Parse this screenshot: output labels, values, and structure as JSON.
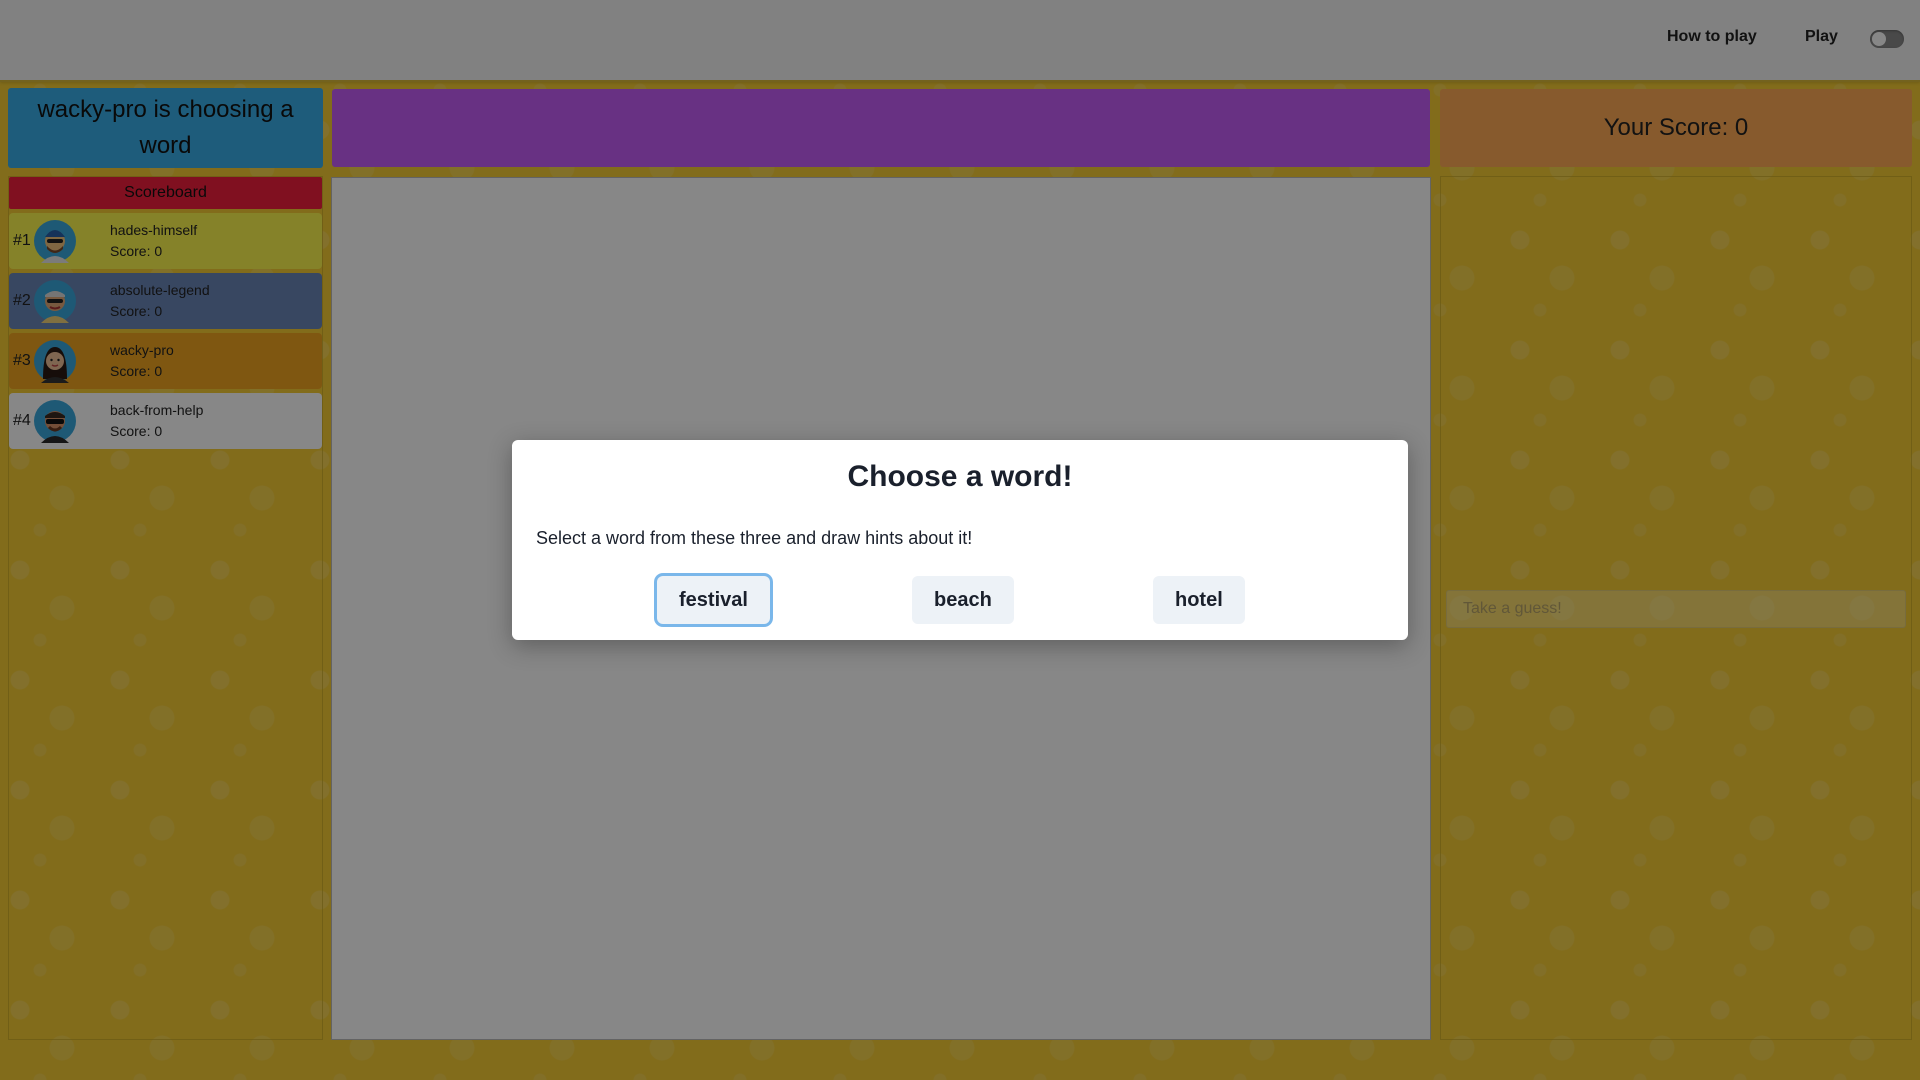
{
  "nav": {
    "how_to_play": "How to play",
    "play": "Play"
  },
  "status": {
    "message": "wacky-pro is choosing a word"
  },
  "score": {
    "label": "Your Score: 0"
  },
  "scoreboard": {
    "title": "Scoreboard",
    "players": [
      {
        "rank": "#1",
        "name": "hades-himself",
        "score": "Score: 0",
        "color": "#fcf54e"
      },
      {
        "rank": "#2",
        "name": "absolute-legend",
        "score": "Score: 0",
        "color": "#6a86b8"
      },
      {
        "rank": "#3",
        "name": "wacky-pro",
        "score": "Score: 0",
        "color": "#f0a520"
      },
      {
        "rank": "#4",
        "name": "back-from-help",
        "score": "Score: 0",
        "color": "#ffffff"
      }
    ]
  },
  "guess": {
    "placeholder": "Take a guess!"
  },
  "modal": {
    "title": "Choose a word!",
    "text": "Select a word from these three and draw hints about it!",
    "words": [
      "festival",
      "beach",
      "hotel"
    ]
  },
  "colors": {
    "background": "#f5cc33",
    "status_panel": "#3aaee8",
    "word_bar": "#c55ef7",
    "score_panel": "#ffaa55",
    "scoreboard_title": "#f21f3d"
  }
}
